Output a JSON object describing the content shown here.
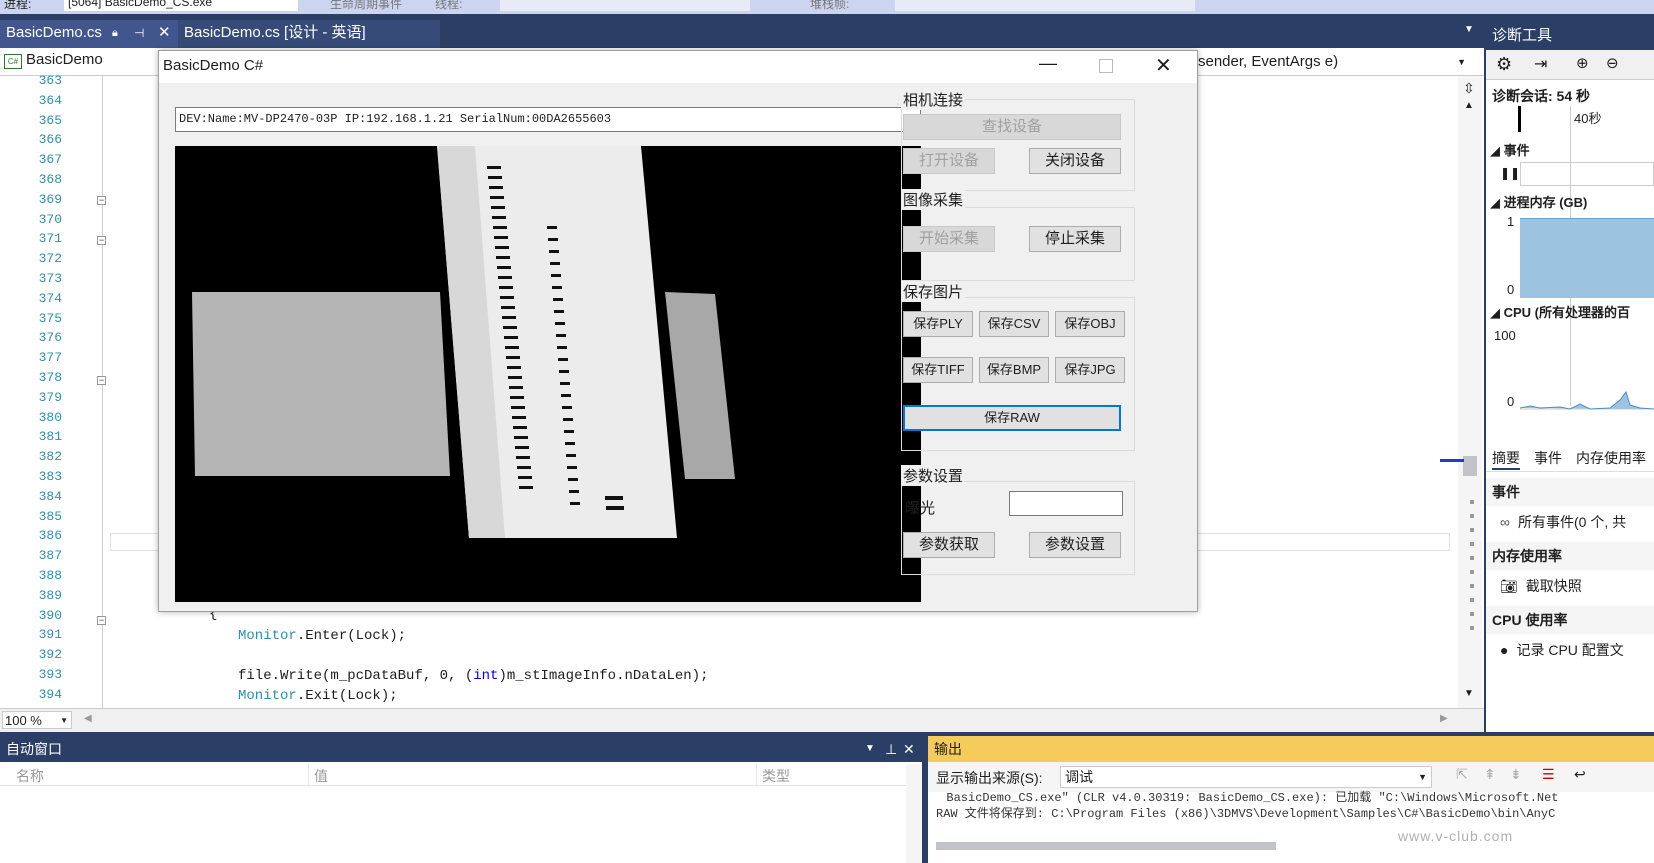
{
  "topbar": {
    "process_label": "进程:",
    "process_value": "[5064] BasicDemo_CS.exe",
    "lifecycle_label": "生命周期事件",
    "thread_label": "线程:",
    "stack_label": "堆栈帧:"
  },
  "tabs": [
    {
      "label": "BasicDemo.cs"
    },
    {
      "label": "BasicDemo.cs [设计 - 英语]"
    }
  ],
  "navbar": {
    "class_name": "BasicDemo",
    "method_sig": "sender, EventArgs e)"
  },
  "editor": {
    "lines": [
      "363",
      "364",
      "365",
      "366",
      "367",
      "368",
      "369",
      "370",
      "371",
      "372",
      "373",
      "374",
      "375",
      "376",
      "377",
      "378",
      "379",
      "380",
      "381",
      "382",
      "383",
      "384",
      "385",
      "386",
      "387",
      "388",
      "389",
      "390",
      "391",
      "392",
      "393",
      "394"
    ],
    "code_brace": "{",
    "code_391_a": "Monitor",
    "code_391_b": ".Enter(Lock);",
    "code_393_a": "file.Write(m_pcDataBuf, 0, (",
    "code_393_kw": "int",
    "code_393_b": ")m_stImageInfo.nDataLen);",
    "code_394_a": "Monitor",
    "code_394_b": ".Exit(Lock);",
    "zoom": "100 %"
  },
  "dialog": {
    "title": "BasicDemo C#",
    "device_combo": "DEV:Name:MV-DP2470-03P IP:192.168.1.21 SerialNum:00DA2655603",
    "group_connect": "相机连接",
    "btn_find": "查找设备",
    "btn_open": "打开设备",
    "btn_close": "关闭设备",
    "group_capture": "图像采集",
    "btn_start": "开始采集",
    "btn_stop": "停止采集",
    "group_save": "保存图片",
    "btn_ply": "保存PLY",
    "btn_csv": "保存CSV",
    "btn_obj": "保存OBJ",
    "btn_tiff": "保存TIFF",
    "btn_bmp": "保存BMP",
    "btn_jpg": "保存JPG",
    "btn_raw": "保存RAW",
    "group_param": "参数设置",
    "exposure_label": "曝光",
    "exposure_value": "",
    "btn_get": "参数获取",
    "btn_set": "参数设置"
  },
  "diag": {
    "title": "诊断工具",
    "session": "诊断会话: 54 秒",
    "timeline_label": "40秒",
    "events_header": "事件",
    "mem_header": "进程内存 (GB)",
    "mem_max": "1",
    "mem_min": "0",
    "cpu_header": "CPU (所有处理器的百",
    "cpu_max": "100",
    "cpu_min": "0",
    "tab_summary": "摘要",
    "tab_events": "事件",
    "tab_mem": "内存使用率",
    "sec_events": "事件",
    "all_events": "所有事件(0 个, 共",
    "sec_mem": "内存使用率",
    "snapshot": "截取快照",
    "sec_cpu": "CPU 使用率",
    "record_cpu": "记录 CPU 配置文"
  },
  "autos": {
    "title": "自动窗口",
    "col_name": "名称",
    "col_value": "值",
    "col_type": "类型"
  },
  "output": {
    "title": "输出",
    "source_label": "显示输出来源(S):",
    "source_value": "调试",
    "line1": "  BasicDemo_CS.exe\" (CLR v4.0.30319: BasicDemo_CS.exe): 已加载 \"C:\\Windows\\Microsoft.Net",
    "line2": "RAW 文件将保存到: C:\\Program Files (x86)\\3DMVS\\Development\\Samples\\C#\\BasicDemo\\bin\\AnyC",
    "watermark": "www.v-club.com"
  },
  "colors": {
    "vs_blue": "#2b3f66",
    "output_yellow": "#f5cc5c",
    "focus_blue": "#0078d7"
  }
}
